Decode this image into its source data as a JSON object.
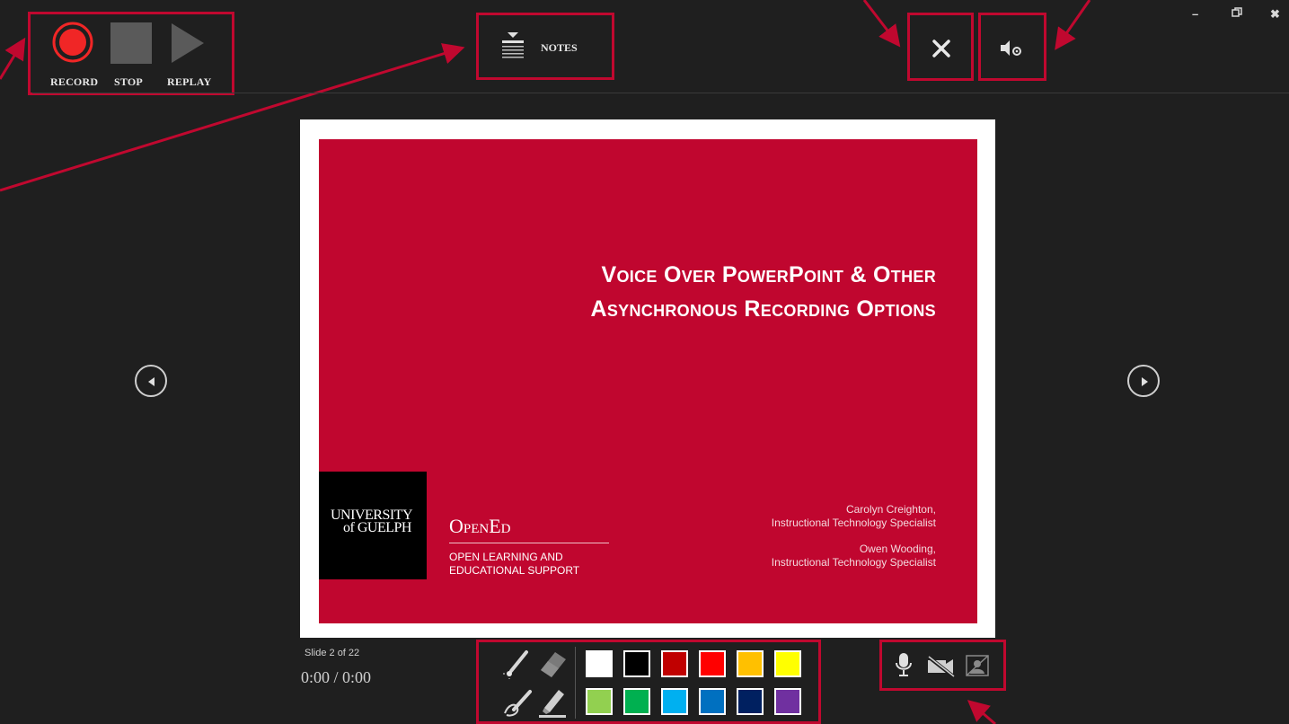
{
  "toolbar": {
    "record_label": "RECORD",
    "stop_label": "STOP",
    "replay_label": "REPLAY",
    "notes_label": "NOTES"
  },
  "slide": {
    "title_line1": "Voice Over PowerPoint & Other",
    "title_line2": "Asynchronous Recording Options",
    "logo_line1": "UNIVERSITY",
    "logo_line2": "of GUELPH",
    "opened_title": "OpenEd",
    "opened_sub1": "OPEN LEARNING AND",
    "opened_sub2": "EDUCATIONAL SUPPORT",
    "presenter1_name": "Carolyn Creighton,",
    "presenter1_role": "Instructional Technology Specialist",
    "presenter2_name": "Owen Wooding,",
    "presenter2_role": "Instructional Technology Specialist"
  },
  "status": {
    "slide_count": "Slide 2 of 22",
    "time": "0:00 / 0:00"
  },
  "colors": {
    "accent": "#c0082f",
    "slide_bg": "#c0062f",
    "record": "#f02626",
    "swatches_row1": [
      "#ffffff",
      "#000000",
      "#c00000",
      "#ff0000",
      "#ffc000",
      "#ffff00"
    ],
    "swatches_row2": [
      "#92d050",
      "#00b050",
      "#00b0f0",
      "#0070c0",
      "#002060",
      "#7030a0"
    ]
  },
  "icons": [
    "record-icon",
    "stop-icon",
    "replay-icon",
    "notes-icon",
    "close-icon",
    "settings-icon",
    "prev-slide-icon",
    "next-slide-icon",
    "laser-pointer-icon",
    "eraser-icon",
    "pen-icon",
    "highlighter-icon",
    "microphone-icon",
    "camera-off-icon",
    "camera-preview-off-icon"
  ]
}
